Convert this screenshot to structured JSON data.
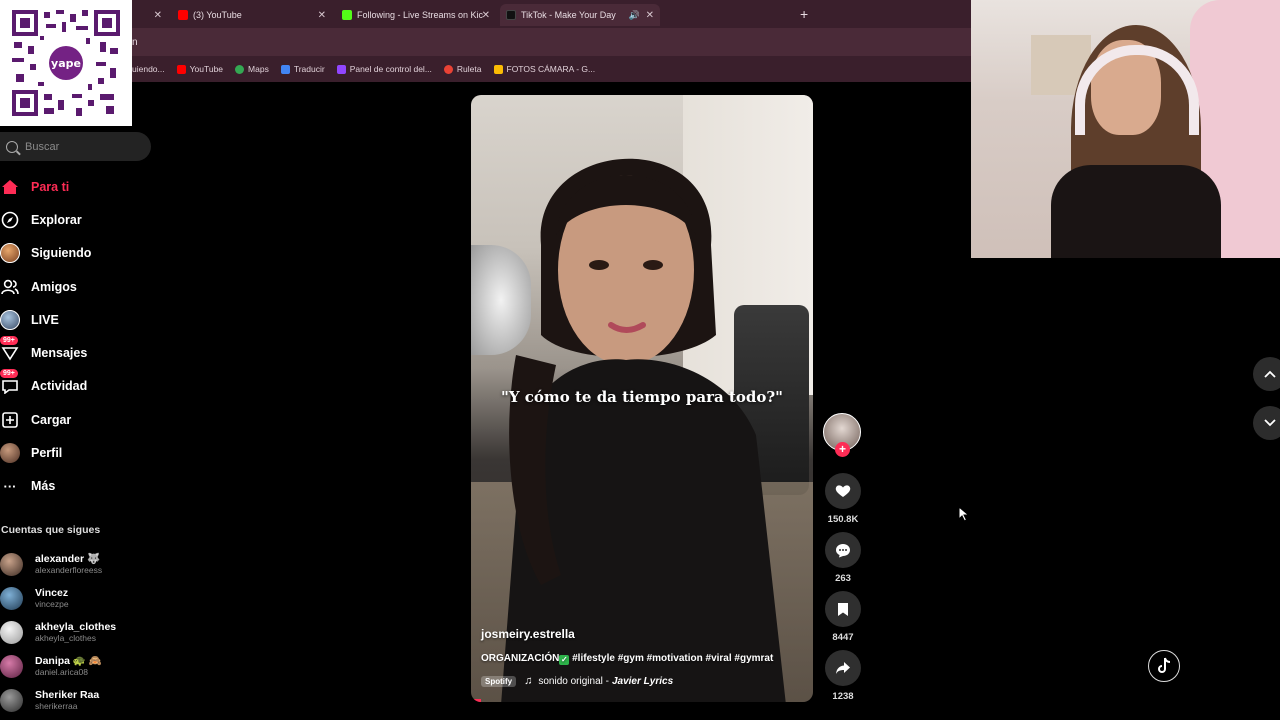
{
  "browser": {
    "tabs": [
      {
        "title": "(3) YouTube",
        "color": "#ff0000"
      },
      {
        "title": "Following - Live Streams on Kic",
        "color": "#53fc18"
      },
      {
        "title": "TikTok - Make Your Day",
        "color": "#111111"
      }
    ],
    "address_fragment": "n",
    "bookmarks": [
      {
        "label": "uiendo...",
        "color": ""
      },
      {
        "label": "YouTube",
        "color": "#ff0000"
      },
      {
        "label": "Maps",
        "color": "#34a853"
      },
      {
        "label": "Traducir",
        "color": "#4285f4"
      },
      {
        "label": "Panel de control del...",
        "color": "#9146ff"
      },
      {
        "label": "Ruleta",
        "color": "#e94235"
      },
      {
        "label": "FOTOS CÁMARA - G...",
        "color": "#fbbc04"
      }
    ]
  },
  "qr": {
    "label": "yape"
  },
  "search": {
    "placeholder": "Buscar"
  },
  "nav": [
    {
      "label": "Para ti",
      "icon": "home-icon"
    },
    {
      "label": "Explorar",
      "icon": "compass-icon"
    },
    {
      "label": "Siguiendo",
      "icon": "avatar"
    },
    {
      "label": "Amigos",
      "icon": "friends-icon"
    },
    {
      "label": "LIVE",
      "icon": "avatar"
    },
    {
      "label": "Mensajes",
      "icon": "message-icon",
      "badge": "99+"
    },
    {
      "label": "Actividad",
      "icon": "bell-icon",
      "badge": "99+"
    },
    {
      "label": "Cargar",
      "icon": "upload-icon"
    },
    {
      "label": "Perfil",
      "icon": "avatar"
    },
    {
      "label": "Más",
      "icon": "more-icon"
    }
  ],
  "following": {
    "title": "Cuentas que sigues",
    "accounts": [
      {
        "name": "alexander 🐺",
        "handle": "alexanderfloreess"
      },
      {
        "name": "Vincez",
        "handle": "vincezpe"
      },
      {
        "name": "akheyla_clothes",
        "handle": "akheyla_clothes"
      },
      {
        "name": "Danipa 🐢 🙈",
        "handle": "daniel.arica08"
      },
      {
        "name": "Sheriker Raa",
        "handle": "sherikerraa"
      }
    ]
  },
  "video": {
    "overlay_text": "\"Y cómo te da tiempo para todo?\"",
    "author": "josmeiry.estrella",
    "desc_prefix": "ORGANIZACIÓN",
    "desc_tags": "#lifestyle #gym #motivation #viral #gymrat",
    "spotify": "Spotify",
    "music": "sonido original -",
    "music_artist": "Javier Lyrics",
    "progress_fraction": 0.03
  },
  "actions": {
    "likes": "150.8K",
    "comments": "263",
    "saves": "8447",
    "shares": "1238"
  }
}
